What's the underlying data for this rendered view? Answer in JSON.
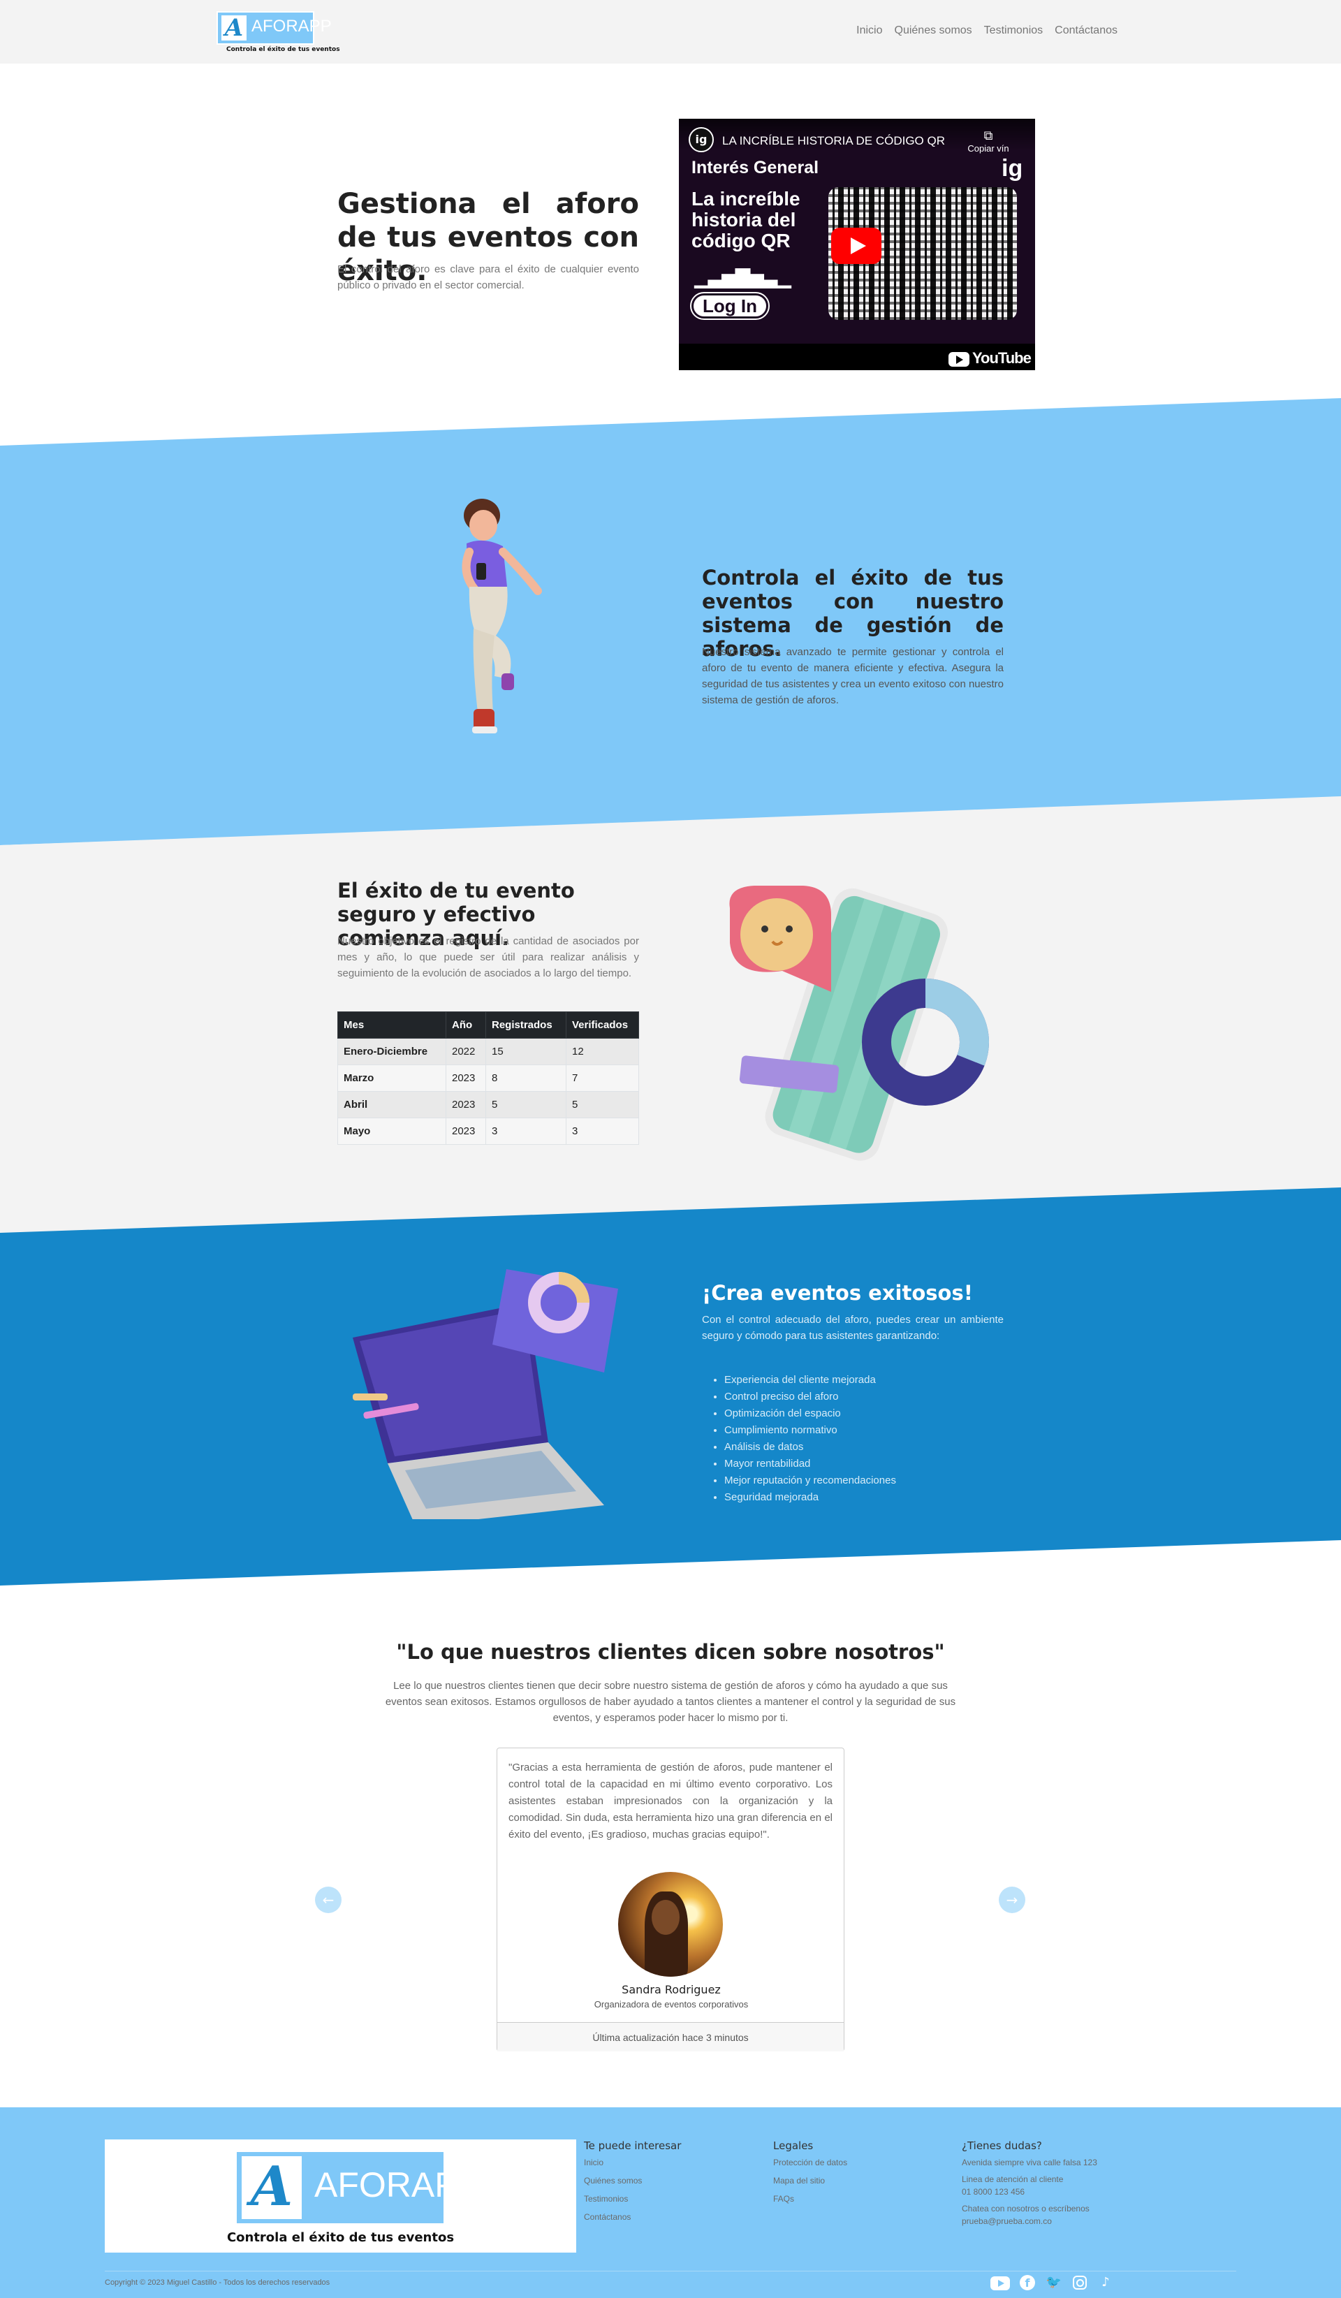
{
  "brand": {
    "logo_letter": "A",
    "logo_word": "AFORAPP",
    "logo_tagline": "Controla el éxito de tus eventos",
    "colors": {
      "light_blue": "#7fc8f8",
      "blue": "#1587c9",
      "grey": "#f3f3f3",
      "dark": "#212529"
    }
  },
  "nav": {
    "items": [
      "Inicio",
      "Quiénes somos",
      "Testimonios",
      "Contáctanos"
    ]
  },
  "hero": {
    "title": "Gestiona el aforo de tus eventos con éxito.",
    "text": "El control del aforo es clave para el éxito de cualquier evento público o privado en el sector comercial.",
    "video": {
      "channel_icon": "ig",
      "title": "LA INCRÍBLE HISTORIA DE CÓDIGO QR",
      "copy_label": "Copiar vín",
      "watermark": "ig",
      "channel_name": "Interés General",
      "headline": "La increíble historia del código QR",
      "login_label": "Log In",
      "youtube_label": "YouTube"
    }
  },
  "section2": {
    "title": "Controla el éxito de tus eventos con nuestro sistema de gestión de aforos.",
    "text": "Nuestro sistema avanzado te permite gestionar y controla el aforo de tu evento de manera eficiente y efectiva. Asegura la seguridad de tus asistentes y crea un evento exitoso con nuestro sistema de gestión de aforos."
  },
  "section3": {
    "title": "El éxito de tu evento seguro y efectivo comienza aquí.",
    "text": "Nuestro objetivo es el registro de la cantidad de asociados por mes y año, lo que puede ser útil para realizar análisis y seguimiento de la evolución de asociados a lo largo del tiempo.",
    "table": {
      "headers": [
        "Mes",
        "Año",
        "Registrados",
        "Verificados"
      ],
      "rows": [
        [
          "Enero-Diciembre",
          "2022",
          "15",
          "12"
        ],
        [
          "Marzo",
          "2023",
          "8",
          "7"
        ],
        [
          "Abril",
          "2023",
          "5",
          "5"
        ],
        [
          "Mayo",
          "2023",
          "3",
          "3"
        ]
      ]
    }
  },
  "section4": {
    "title": "¡Crea eventos exitosos!",
    "text": "Con el control adecuado del aforo, puedes crear un ambiente seguro y cómodo para tus asistentes garantizando:",
    "list": [
      "Experiencia del cliente mejorada",
      "Control preciso del aforo",
      "Optimización del espacio",
      "Cumplimiento normativo",
      "Análisis de datos",
      "Mayor rentabilidad",
      "Mejor reputación y recomendaciones",
      "Seguridad mejorada"
    ]
  },
  "testimonials": {
    "title": "\"Lo que nuestros clientes dicen sobre nosotros\"",
    "text": "Lee lo que nuestros clientes tienen que decir sobre nuestro sistema de gestión de aforos y cómo ha ayudado a que sus eventos sean exitosos. Estamos orgullosos de haber ayudado a tantos clientes a mantener el control y la seguridad de sus eventos, y esperamos poder hacer lo mismo por ti.",
    "card": {
      "quote": "\"Gracias a esta herramienta de gestión de aforos, pude mantener el control total de la capacidad en mi último evento corporativo. Los asistentes estaban impresionados con la organización y la comodidad. Sin duda, esta herramienta hizo una gran diferencia en el éxito del evento, ¡Es gradioso, muchas gracias equipo!\".",
      "name": "Sandra Rodriguez",
      "role": "Organizadora de eventos corporativos",
      "updated": "Última actualización hace 3 minutos"
    },
    "prev_icon": "arrow-left-icon",
    "next_icon": "arrow-right-icon"
  },
  "footer": {
    "col1": {
      "title": "Te puede interesar",
      "links": [
        "Inicio",
        "Quiénes somos",
        "Testimonios",
        "Contáctanos"
      ]
    },
    "col2": {
      "title": "Legales",
      "links": [
        "Protección de datos",
        "Mapa del sitio",
        "FAQs"
      ]
    },
    "col3": {
      "title": "¿Tienes dudas?",
      "address": "Avenida siempre viva calle falsa 123",
      "phone_label": "Linea de atención al cliente",
      "phone": "01 8000 123 456",
      "chat_label": "Chatea con nosotros o escríbenos",
      "email": "prueba@prueba.com.co"
    },
    "copyright": "Copyright © 2023 Miguel Castillo - Todos los derechos reservados",
    "socials": [
      "youtube-icon",
      "facebook-icon",
      "twitter-icon",
      "instagram-icon",
      "tiktok-icon"
    ]
  }
}
